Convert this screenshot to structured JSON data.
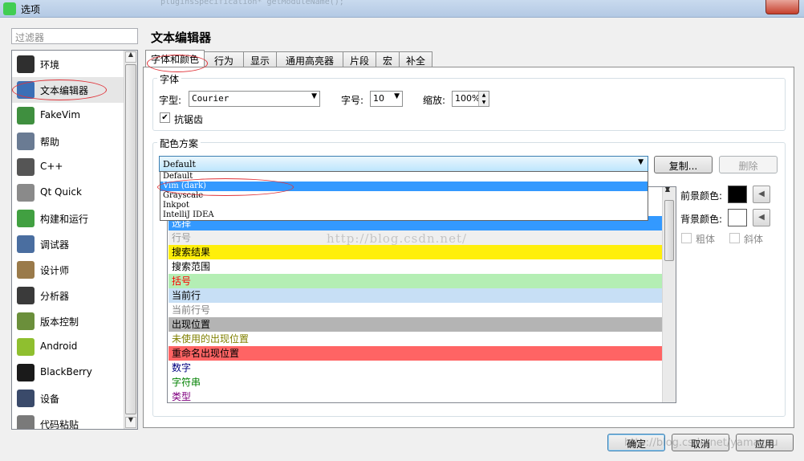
{
  "window": {
    "title": "选项",
    "code_ghost": "pluginsSpecification* getModuleName();"
  },
  "filter": {
    "placeholder": "过滤器"
  },
  "sidebar": {
    "items": [
      {
        "label": "环境",
        "icon": "monitor-icon",
        "color": "#2f2f2f"
      },
      {
        "label": "文本编辑器",
        "icon": "text-editor-icon",
        "color": "#3b6fb6"
      },
      {
        "label": "FakeVim",
        "icon": "fakevim-icon",
        "color": "#3f8f3f"
      },
      {
        "label": "帮助",
        "icon": "help-icon",
        "color": "#6a7b93"
      },
      {
        "label": "C++",
        "icon": "cpp-braces-icon",
        "color": "#555555"
      },
      {
        "label": "Qt Quick",
        "icon": "qt-quick-icon",
        "color": "#8a8a8a"
      },
      {
        "label": "构建和运行",
        "icon": "build-run-icon",
        "color": "#41a041"
      },
      {
        "label": "调试器",
        "icon": "debugger-icon",
        "color": "#4a6ea0"
      },
      {
        "label": "设计师",
        "icon": "designer-icon",
        "color": "#9a7a4a"
      },
      {
        "label": "分析器",
        "icon": "analyzer-icon",
        "color": "#3a3a3a"
      },
      {
        "label": "版本控制",
        "icon": "version-control-icon",
        "color": "#6b8f3b"
      },
      {
        "label": "Android",
        "icon": "android-icon",
        "color": "#8fbf2f"
      },
      {
        "label": "BlackBerry",
        "icon": "blackberry-icon",
        "color": "#1a1a1a"
      },
      {
        "label": "设备",
        "icon": "device-icon",
        "color": "#3a4a6a"
      },
      {
        "label": "代码粘贴",
        "icon": "code-paste-icon",
        "color": "#7a7a7a"
      }
    ],
    "selected_index": 1
  },
  "page": {
    "title": "文本编辑器"
  },
  "tabs": [
    "字体和颜色",
    "行为",
    "显示",
    "通用高亮器",
    "片段",
    "宏",
    "补全"
  ],
  "font_group": {
    "title": "字体",
    "family_label": "字型:",
    "family_value": "Courier",
    "size_label": "字号:",
    "size_value": "10",
    "zoom_label": "缩放:",
    "zoom_value": "100%",
    "antialias_label": "抗锯齿",
    "antialias_checked": "✔"
  },
  "scheme_group": {
    "title": "配色方案",
    "selected": "Default",
    "options": [
      "Default",
      "Vim (dark)",
      "Grayscale",
      "Inkpot",
      "IntelliJ IDEA"
    ],
    "highlighted_index": 1,
    "copy_label": "复制...",
    "delete_label": "删除"
  },
  "color_items": [
    {
      "label": "选择",
      "fg": "#ffffff",
      "bg": "#3399ff"
    },
    {
      "label": "行号",
      "fg": "#9a9a9a",
      "bg": "#efefef"
    },
    {
      "label": "搜索结果",
      "fg": "#000000",
      "bg": "#ffef0b"
    },
    {
      "label": "搜索范围",
      "fg": "#000000",
      "bg": "#ffffff"
    },
    {
      "label": "括号",
      "fg": "#ff0000",
      "bg": "#b4eeb4"
    },
    {
      "label": "当前行",
      "fg": "#000000",
      "bg": "#c7dff5"
    },
    {
      "label": "当前行号",
      "fg": "#808080",
      "bg": "#ffffff"
    },
    {
      "label": "出现位置",
      "fg": "#000000",
      "bg": "#b4b4b4"
    },
    {
      "label": "未使用的出现位置",
      "fg": "#808000",
      "bg": "#ffffff"
    },
    {
      "label": "重命名出现位置",
      "fg": "#000000",
      "bg": "#ff6464"
    },
    {
      "label": "数字",
      "fg": "#000080",
      "bg": "#ffffff"
    },
    {
      "label": "字符串",
      "fg": "#008000",
      "bg": "#ffffff"
    },
    {
      "label": "类型",
      "fg": "#800080",
      "bg": "#ffffff"
    }
  ],
  "props": {
    "fg_label": "前景颜色:",
    "fg_color": "#000000",
    "bg_label": "背景颜色:",
    "bg_color": "#ffffff",
    "bold_label": "粗体",
    "italic_label": "斜体",
    "reset_glyph": "◀"
  },
  "footer": {
    "ok": "确定",
    "cancel": "取消",
    "apply": "应用"
  },
  "watermark": {
    "center": "http://blog.csdn.net/",
    "bottom": "http://blog.csdn.net/yamazou"
  }
}
